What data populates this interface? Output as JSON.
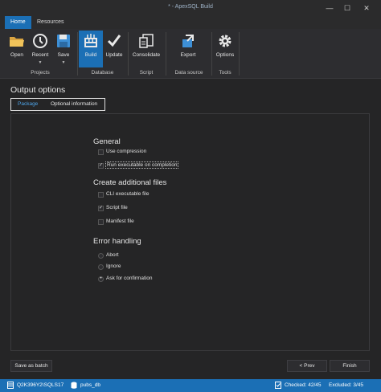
{
  "window": {
    "title": "* - ApexSQL Build",
    "minimize": "—",
    "maximize": "☐",
    "close": "✕"
  },
  "ribbon_tabs": [
    "Home",
    "Resources"
  ],
  "ribbon": {
    "buttons": {
      "open": "Open",
      "recent": "Recent",
      "save": "Save",
      "build": "Build",
      "update": "Update",
      "consolidate": "Consolidate",
      "export": "Export",
      "options": "Options"
    },
    "groups": {
      "projects": "Projects",
      "database": "Database",
      "script": "Script",
      "data_source": "Data source",
      "tools": "Tools"
    }
  },
  "section_title": "Output options",
  "subtabs": [
    "Package",
    "Optional information"
  ],
  "general": {
    "heading": "General",
    "options": [
      {
        "label": "Use compression",
        "checked": false
      },
      {
        "label": "Run executable on completion",
        "checked": true
      }
    ]
  },
  "additional_files": {
    "heading": "Create additional files",
    "options": [
      {
        "label": "CLI executable file",
        "checked": false
      },
      {
        "label": "Script file",
        "checked": true
      },
      {
        "label": "Manifest file",
        "checked": false
      }
    ]
  },
  "error_handling": {
    "heading": "Error handling",
    "options": [
      {
        "label": "Abort",
        "selected": false
      },
      {
        "label": "Ignore",
        "selected": false
      },
      {
        "label": "Ask for confirmation",
        "selected": true
      }
    ]
  },
  "check_mark": "✓",
  "radio_mark": "•",
  "buttons": {
    "save_as_batch": "Save as batch",
    "prev": "< Prev",
    "finish": "Finish"
  },
  "status": {
    "server": "Q2K396Y2\\SQLS17",
    "database": "pubs_db",
    "checked": "Checked: 42/45",
    "excluded": "Excluded: 3/45"
  },
  "colors": {
    "accent": "#1b6fb5",
    "background": "#252526",
    "ribbon": "#2d2d30",
    "link_tab": "#4ea3e6"
  }
}
